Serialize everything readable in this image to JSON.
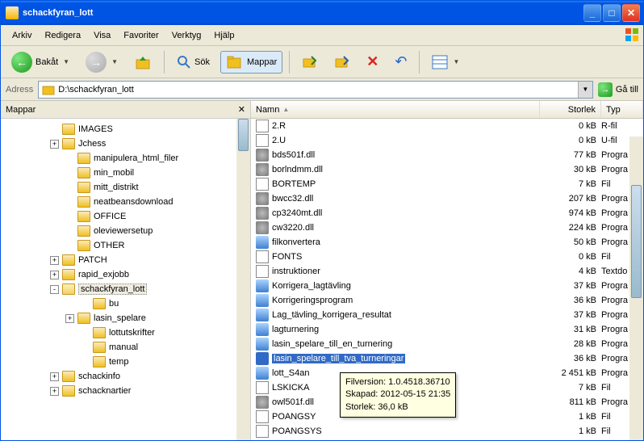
{
  "title": "schackfyran_lott",
  "menu": {
    "arkiv": "Arkiv",
    "redigera": "Redigera",
    "visa": "Visa",
    "favoriter": "Favoriter",
    "verktyg": "Verktyg",
    "hjalp": "Hjälp"
  },
  "toolbar": {
    "back": "Bakåt",
    "search": "Sök",
    "folders": "Mappar"
  },
  "address": {
    "label": "Adress",
    "value": "D:\\schackfyran_lott",
    "go": "Gå till"
  },
  "left": {
    "title": "Mappar",
    "items": [
      {
        "ind": 3,
        "exp": "",
        "label": "IMAGES",
        "open": false
      },
      {
        "ind": 3,
        "exp": "+",
        "label": "Jchess",
        "open": false
      },
      {
        "ind": 4,
        "exp": "",
        "label": "manipulera_html_filer",
        "open": false
      },
      {
        "ind": 4,
        "exp": "",
        "label": "min_mobil",
        "open": false
      },
      {
        "ind": 4,
        "exp": "",
        "label": "mitt_distrikt",
        "open": false
      },
      {
        "ind": 4,
        "exp": "",
        "label": "neatbeansdownload",
        "open": false
      },
      {
        "ind": 4,
        "exp": "",
        "label": "OFFICE",
        "open": false
      },
      {
        "ind": 4,
        "exp": "",
        "label": "oleviewersetup",
        "open": false
      },
      {
        "ind": 4,
        "exp": "",
        "label": "OTHER",
        "open": false
      },
      {
        "ind": 3,
        "exp": "+",
        "label": "PATCH",
        "open": false
      },
      {
        "ind": 3,
        "exp": "+",
        "label": "rapid_exjobb",
        "open": false
      },
      {
        "ind": 3,
        "exp": "-",
        "label": "schackfyran_lott",
        "open": true,
        "sel": true
      },
      {
        "ind": 5,
        "exp": "",
        "label": "bu",
        "open": false
      },
      {
        "ind": 4,
        "exp": "+",
        "label": "lasin_spelare",
        "open": false
      },
      {
        "ind": 5,
        "exp": "",
        "label": "lottutskrifter",
        "open": false
      },
      {
        "ind": 5,
        "exp": "",
        "label": "manual",
        "open": false
      },
      {
        "ind": 5,
        "exp": "",
        "label": "temp",
        "open": false
      },
      {
        "ind": 3,
        "exp": "+",
        "label": "schackinfo",
        "open": false
      },
      {
        "ind": 3,
        "exp": "+",
        "label": "schacknartier",
        "open": false
      }
    ]
  },
  "columns": {
    "name": "Namn",
    "size": "Storlek",
    "type": "Typ"
  },
  "files": [
    {
      "name": "2.R",
      "size": "0 kB",
      "type": "R-fil",
      "icon": "page"
    },
    {
      "name": "2.U",
      "size": "0 kB",
      "type": "U-fil",
      "icon": "page"
    },
    {
      "name": "bds501f.dll",
      "size": "77 kB",
      "type": "Progra",
      "icon": "gear"
    },
    {
      "name": "borlndmm.dll",
      "size": "30 kB",
      "type": "Progra",
      "icon": "gear"
    },
    {
      "name": "BORTEMP",
      "size": "7 kB",
      "type": "Fil",
      "icon": "page"
    },
    {
      "name": "bwcc32.dll",
      "size": "207 kB",
      "type": "Progra",
      "icon": "gear"
    },
    {
      "name": "cp3240mt.dll",
      "size": "974 kB",
      "type": "Progra",
      "icon": "gear"
    },
    {
      "name": "cw3220.dll",
      "size": "224 kB",
      "type": "Progra",
      "icon": "gear"
    },
    {
      "name": "filkonvertera",
      "size": "50 kB",
      "type": "Progra",
      "icon": "blue"
    },
    {
      "name": "FONTS",
      "size": "0 kB",
      "type": "Fil",
      "icon": "page"
    },
    {
      "name": "instruktioner",
      "size": "4 kB",
      "type": "Textdo",
      "icon": "page"
    },
    {
      "name": "Korrigera_lagtävling",
      "size": "37 kB",
      "type": "Progra",
      "icon": "blue"
    },
    {
      "name": "Korrigeringsprogram",
      "size": "36 kB",
      "type": "Progra",
      "icon": "blue"
    },
    {
      "name": "Lag_tävling_korrigera_resultat",
      "size": "37 kB",
      "type": "Progra",
      "icon": "blue"
    },
    {
      "name": "lagturnering",
      "size": "31 kB",
      "type": "Progra",
      "icon": "blue"
    },
    {
      "name": "lasin_spelare_till_en_turnering",
      "size": "28 kB",
      "type": "Progra",
      "icon": "blue"
    },
    {
      "name": "lasin_spelare_till_tva_turneringar",
      "size": "36 kB",
      "type": "Progra",
      "icon": "blue",
      "sel": true
    },
    {
      "name": "lott_S4an",
      "size": "2 451 kB",
      "type": "Progra",
      "icon": "blue"
    },
    {
      "name": "LSKICKA",
      "size": "7 kB",
      "type": "Fil",
      "icon": "page"
    },
    {
      "name": "owl501f.dll",
      "size": "811 kB",
      "type": "Progra",
      "icon": "gear"
    },
    {
      "name": "POANGSY",
      "size": "1 kB",
      "type": "Fil",
      "icon": "page"
    },
    {
      "name": "POANGSYS",
      "size": "1 kB",
      "type": "Fil",
      "icon": "page"
    }
  ],
  "tooltip": {
    "line1": "Filversion: 1.0.4518.36710",
    "line2": "Skapad: 2012-05-15 21:35",
    "line3": "Storlek: 36,0 kB"
  }
}
